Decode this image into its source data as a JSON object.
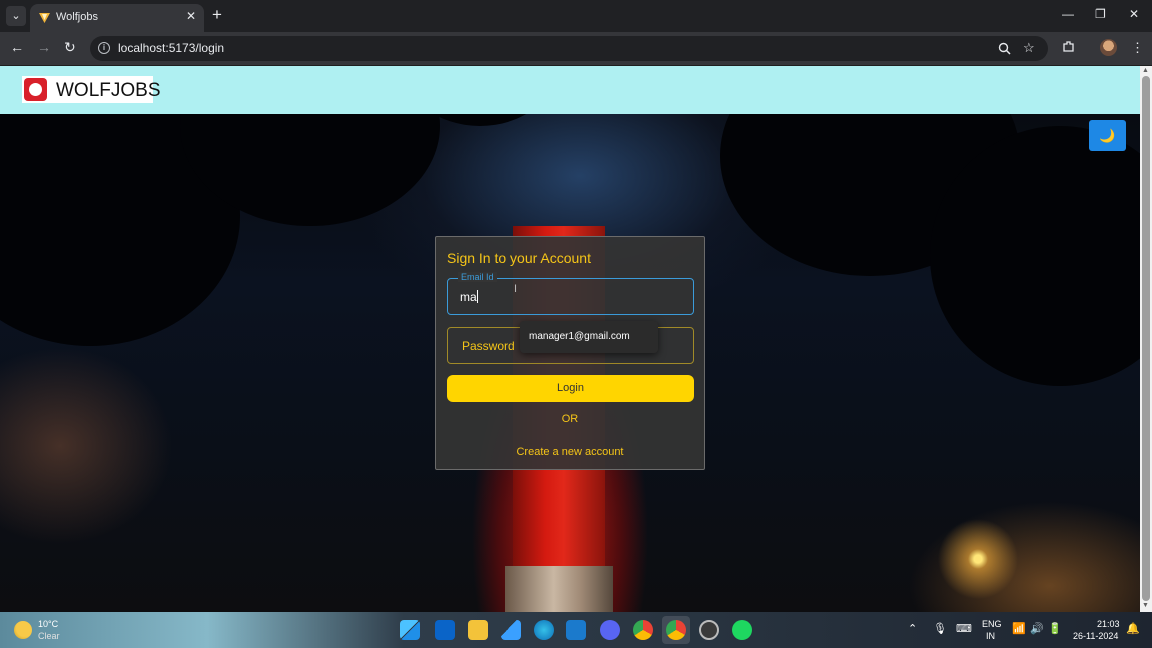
{
  "browser": {
    "tab_title": "Wolfjobs",
    "tab_close": "✕",
    "new_tab": "+",
    "url": "localhost:5173/login",
    "window_controls": {
      "minimize": "—",
      "restore": "❐",
      "close": "✕"
    }
  },
  "header": {
    "logo_text": "WOLFJOBS"
  },
  "theme_toggle": {
    "icon": "🌙"
  },
  "login_card": {
    "title": "Sign In to your Account",
    "email_label": "Email Id",
    "email_value": "ma",
    "password_label": "Password",
    "login_button": "Login",
    "or_text": "OR",
    "create_account_link": "Create a new account"
  },
  "autofill": {
    "suggestion": "manager1@gmail.com"
  },
  "taskbar": {
    "weather_temp": "10°C",
    "weather_desc": "Clear",
    "language": "ENG",
    "region": "IN",
    "time": "21:03",
    "date": "26-11-2024"
  },
  "colors": {
    "accent_yellow": "#ffd500",
    "header_bg": "#aff0f2",
    "focus_blue": "#3b9bd9"
  }
}
